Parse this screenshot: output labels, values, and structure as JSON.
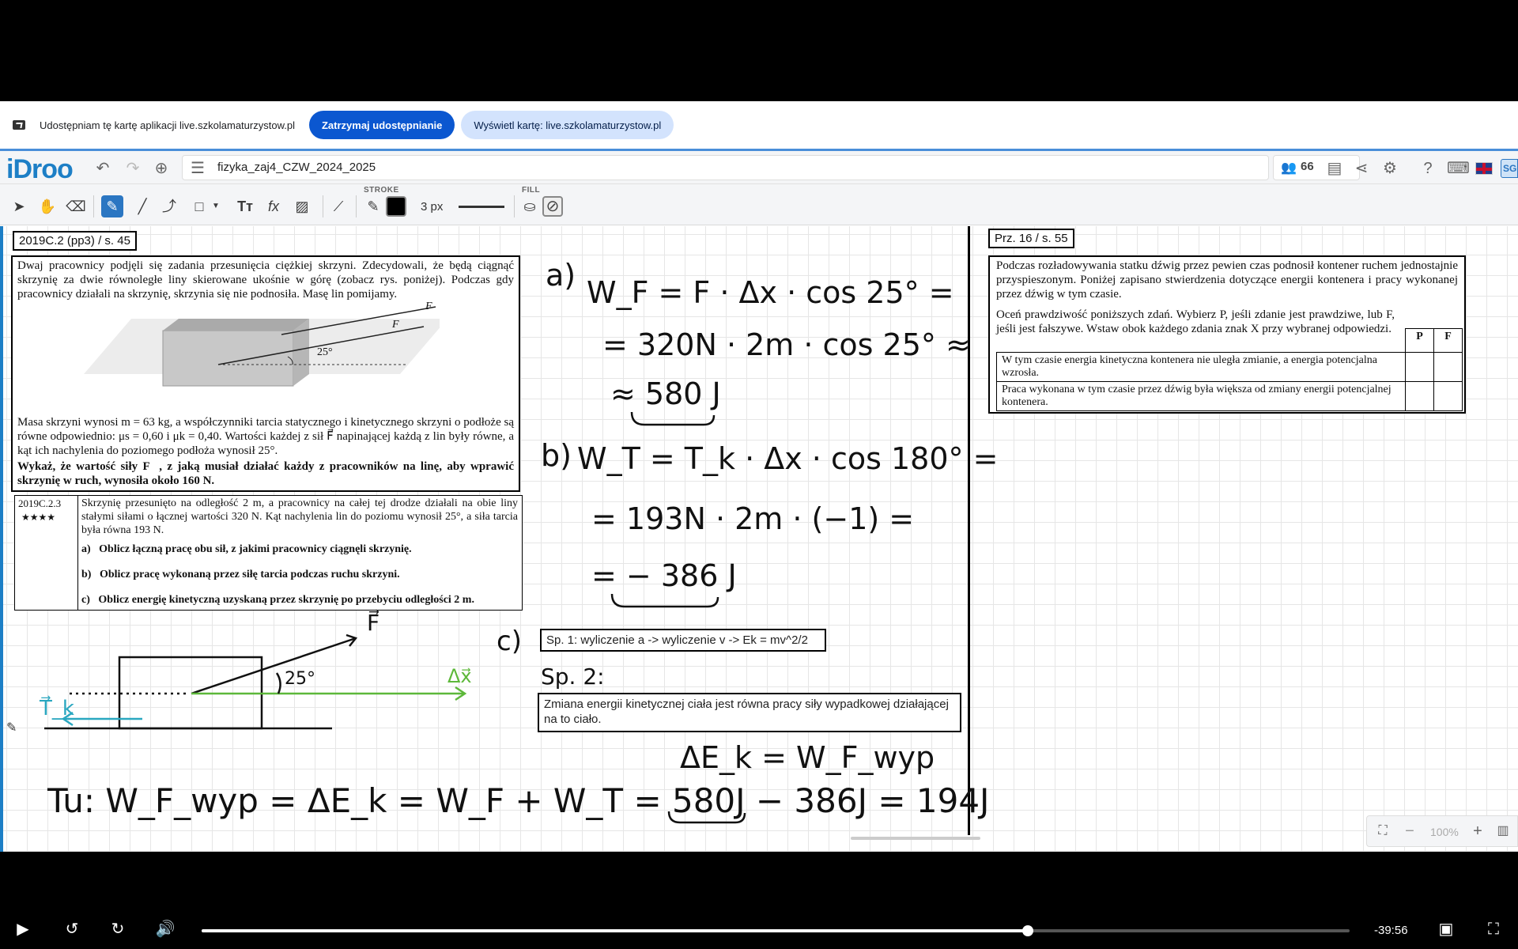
{
  "share": {
    "text": "Udostępniam tę kartę aplikacji live.szkolamaturzystow.pl",
    "stop_label": "Zatrzymaj udostępnianie",
    "view_label": "Wyświetl kartę: live.szkolamaturzystow.pl"
  },
  "app": {
    "logo": "iDroo",
    "filename": "fizyka_zaj4_CZW_2024_2025",
    "users_count": "66",
    "stroke_label": "STROKE",
    "fill_label": "FILL",
    "stroke_width": "3 px",
    "stroke_color": "#000000",
    "accent": "#2b76c2",
    "lang_icon": "uk-flag-icon",
    "sg_label": "SG"
  },
  "zoom": {
    "level": "100%"
  },
  "left_doc": {
    "label": "2019C.2 (pp3) / s. 45",
    "intro": "Dwaj pracownicy podjęli się zadania przesunięcia ciężkiej skrzyni. Zdecydowali, że będą ciągnąć skrzynię za dwie równoległe liny skierowane ukośnie w górę (zobacz rys. poniżej). Podczas gdy pracownicy działali na skrzynię, skrzynia się nie podnosiła. Masę lin pomijamy.",
    "fig_f1": "F⃗",
    "fig_f2": "F⃗",
    "fig_angle": "25°",
    "body": "Masa skrzyni wynosi m = 63 kg, a współczynniki tarcia statycznego i kinetycznego skrzyni o podłoże są równe odpowiednio: μs = 0,60 i μk = 0,40. Wartości każdej z sił F⃗ napinającej każdą z lin były równe, a kąt ich nachylenia do poziomego podłoża wynosił 25°.",
    "task": "Wykaż, że wartość siły F⃗, z jaką musiał działać każdy z pracowników na linę, aby wprawić skrzynię w ruch, wynosiła około 160 N."
  },
  "sub_doc": {
    "code": "2019C.2.3",
    "stars": "★★★★",
    "intro": "Skrzynię przesunięto na odległość 2 m, a pracownicy na całej tej drodze działali na obie liny stałymi siłami o łącznej wartości 320 N. Kąt nachylenia lin do poziomu wynosił 25°, a siła tarcia była równa 193 N.",
    "items": [
      {
        "letter": "a)",
        "text": "Oblicz łączną pracę obu sił, z jakimi pracownicy ciągnęli skrzynię."
      },
      {
        "letter": "b)",
        "text": "Oblicz pracę wykonaną przez siłę tarcia podczas ruchu skrzyni."
      },
      {
        "letter": "c)",
        "text": "Oblicz energię kinetyczną uzyskaną przez skrzynię po przebyciu odległości 2 m."
      }
    ]
  },
  "handwriting": {
    "a_label": "a)",
    "a_line1": "W_F = F · Δx · cos 25° =",
    "a_line2": "= 320N · 2m · cos 25° ≈",
    "a_line3": "≈ 580 J",
    "b_label": "b)",
    "b_line1": "W_T = T_k · Δx · cos 180° =",
    "b_line2": "= 193N · 2m · (−1) =",
    "b_line3": "= − 386 J",
    "c_label": "c)",
    "sp2": "Sp. 2:",
    "dek": "ΔE_k = W_F_wyp",
    "fig_F": "F⃗",
    "fig_angle": "25°",
    "fig_Tk": "T⃗_k",
    "fig_dx": "Δx⃗",
    "bottom": "Tu: W_F_wyp = ΔE_k = W_F + W_T = 580J − 386J = 194J"
  },
  "textboxes": {
    "sp1": "Sp. 1: wyliczenie a -> wyliczenie v -> Ek = mv^2/2",
    "theorem": "Zmiana energii kinetycznej ciała jest równa pracy siły wypadkowej działającej na to ciało."
  },
  "right_doc": {
    "label": "Prz. 16 / s. 55",
    "p1": "Podczas rozładowywania statku dźwig przez pewien czas podnosił kontener ruchem jednostajnie przyspieszonym. Poniżej zapisano stwierdzenia dotyczące energii kontenera i pracy wykonanej przez dźwig w tym czasie.",
    "p2": "Oceń prawdziwość poniższych zdań. Wybierz P, jeśli zdanie jest prawdziwe, lub F, jeśli jest fałszywe. Wstaw obok każdego zdania znak X przy wybranej odpowiedzi.",
    "col_p": "P",
    "col_f": "F",
    "rows": [
      "W tym czasie energia kinetyczna kontenera nie uległa zmianie, a energia potencjalna wzrosła.",
      "Praca wykonana w tym czasie przez dźwig była większa od zmiany energii potencjalnej kontenera."
    ]
  },
  "player": {
    "time_left": "-39:56",
    "progress": 0.72
  }
}
